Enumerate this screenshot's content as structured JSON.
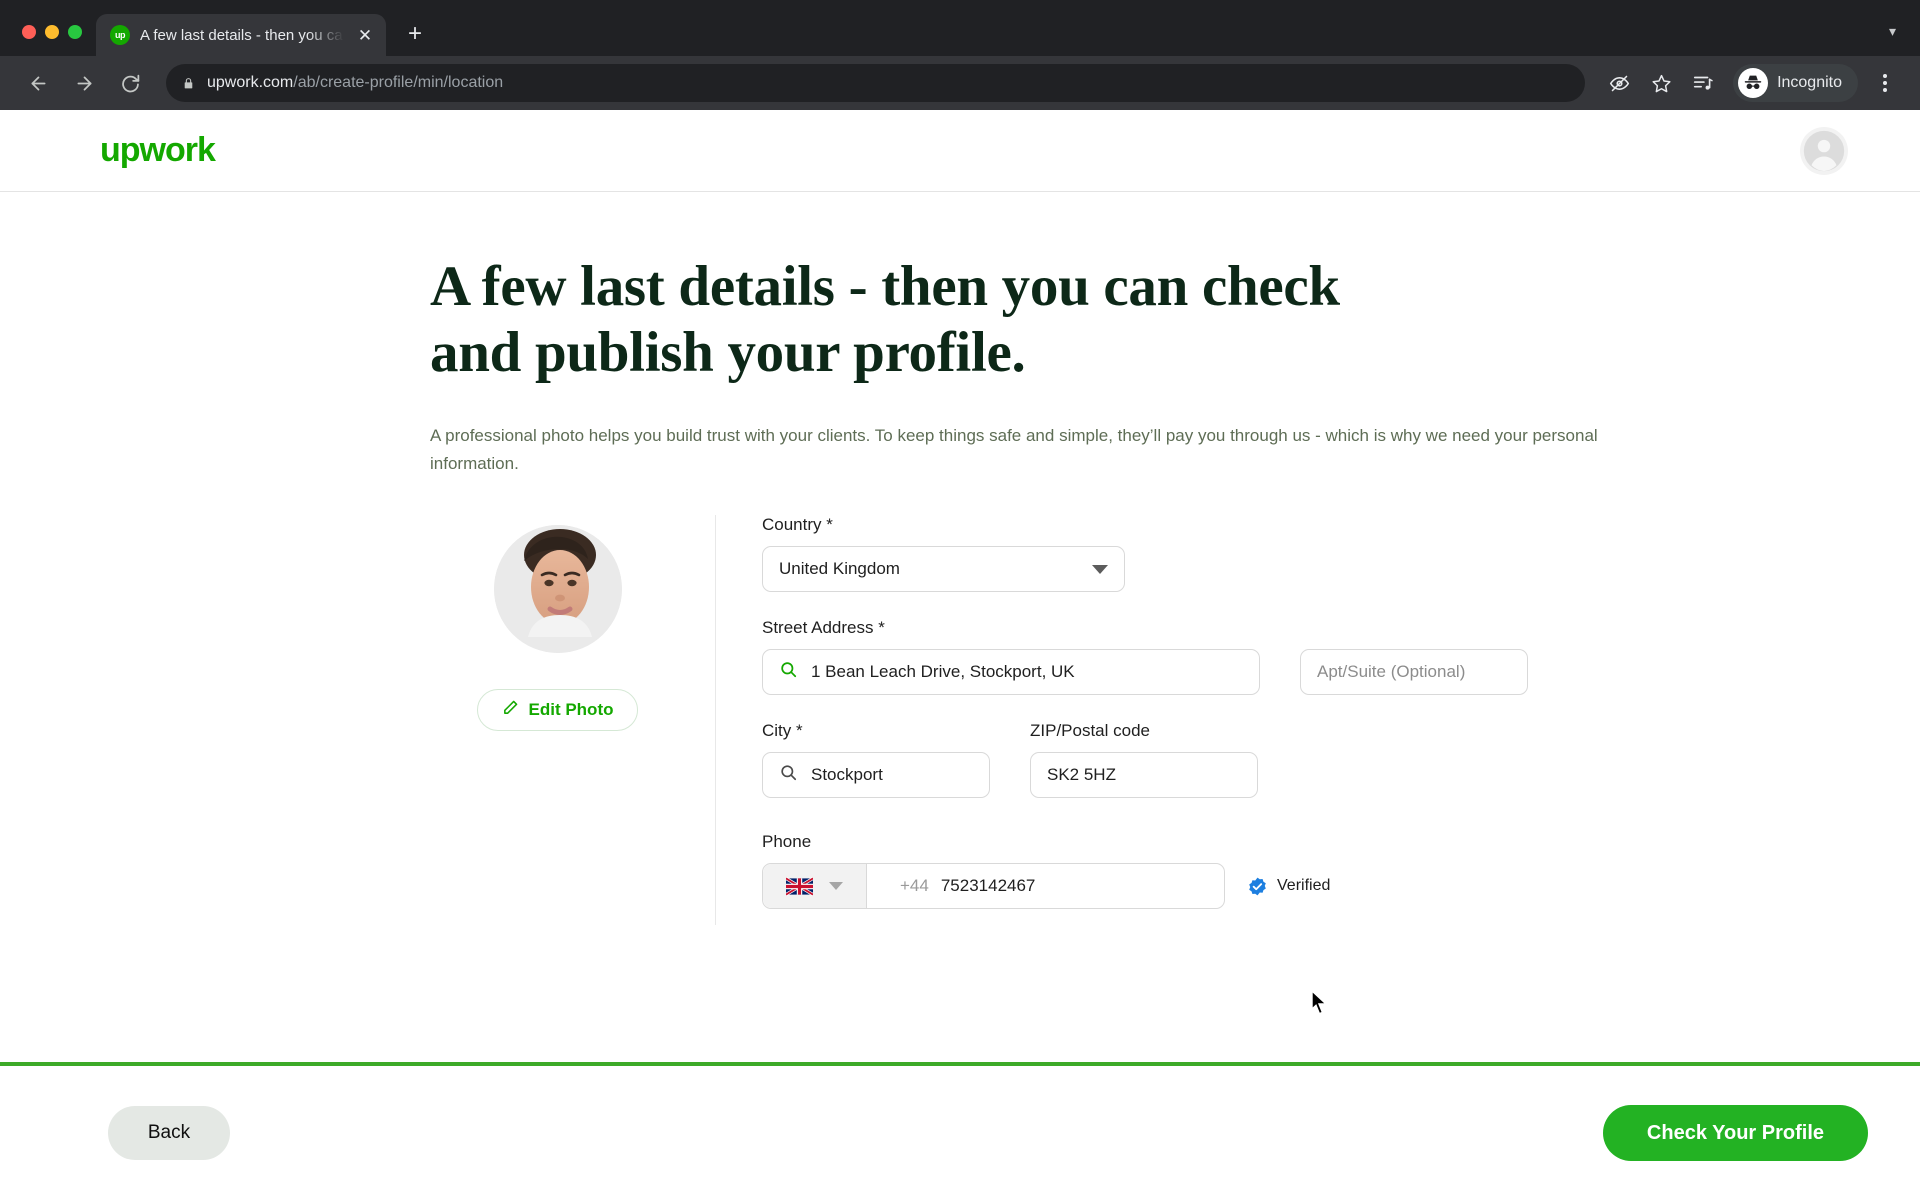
{
  "browser": {
    "window_controls": [
      "close",
      "minimize",
      "maximize"
    ],
    "tab": {
      "favicon_label": "up",
      "title": "A few last details - then you ca",
      "close_label": "✕"
    },
    "new_tab_label": "+",
    "tab_list_chevron": "▾",
    "nav": {
      "back": "←",
      "forward": "→",
      "reload": "↻"
    },
    "omnibox": {
      "lock_icon": "lock-icon",
      "url_domain": "upwork.com",
      "url_path": "/ab/create-profile/min/location"
    },
    "toolbar_icons": [
      "eye-off-icon",
      "star-icon",
      "reading-list-icon"
    ],
    "profile": {
      "label": "Incognito",
      "icon": "incognito-icon"
    },
    "menu_label": "⋮"
  },
  "site_header": {
    "logo_text": "upwork",
    "avatar_icon": "account-circle-icon"
  },
  "main": {
    "headline": "A few last details - then you can check and publish your profile.",
    "subcopy": "A professional photo helps you build trust with your clients. To keep things safe and simple, they’ll pay you through us - which is why we need your personal information.",
    "photo": {
      "alt": "profile-photo",
      "edit_label": "Edit Photo",
      "edit_icon": "pencil-icon"
    },
    "fields": {
      "country": {
        "label": "Country *",
        "value": "United Kingdom",
        "icon": "chevron-down-icon"
      },
      "street_address": {
        "label": "Street Address *",
        "value": "1 Bean Leach Drive, Stockport, UK",
        "icon": "search-icon"
      },
      "apt": {
        "placeholder": "Apt/Suite (Optional)",
        "value": ""
      },
      "city": {
        "label": "City *",
        "value": "Stockport",
        "icon": "search-icon"
      },
      "zip": {
        "label": "ZIP/Postal code",
        "value": "SK2 5HZ"
      },
      "phone": {
        "label": "Phone",
        "flag": "uk-flag-icon",
        "dropdown_icon": "chevron-down-icon",
        "prefix": "+44",
        "value": "7523142467",
        "verified_label": "Verified",
        "verified_icon": "verified-badge-icon"
      }
    }
  },
  "footer": {
    "back_label": "Back",
    "primary_label": "Check Your Profile"
  },
  "colors": {
    "brand_green": "#14a800",
    "button_green": "#23b223",
    "bar_green": "#3daa28",
    "verified_blue": "#1d7fe0",
    "heading_dark": "#0d2818"
  }
}
